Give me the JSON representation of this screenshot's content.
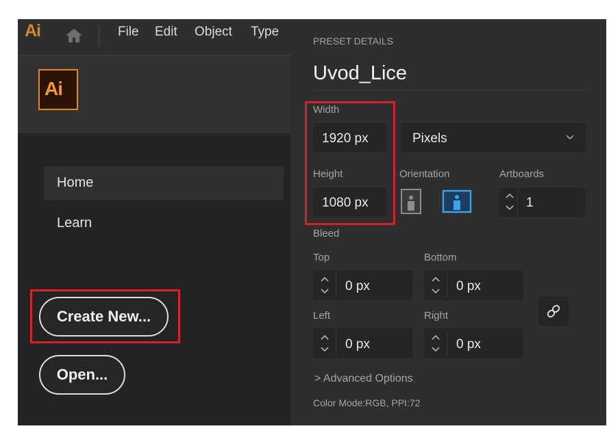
{
  "app": {
    "mark": "Ai",
    "logo_text": "Ai"
  },
  "menu": [
    "File",
    "Edit",
    "Object",
    "Type"
  ],
  "nav": {
    "home": "Home",
    "learn": "Learn"
  },
  "buttons": {
    "create_new": "Create New...",
    "open": "Open..."
  },
  "preset": {
    "section_label": "PRESET DETAILS",
    "name": "Uvod_Lice",
    "width_label": "Width",
    "width_value": "1920 px",
    "units": "Pixels",
    "height_label": "Height",
    "height_value": "1080 px",
    "orientation_label": "Orientation",
    "orientation_selected": "landscape",
    "artboards_label": "Artboards",
    "artboards_value": "1",
    "bleed_label": "Bleed",
    "bleed": {
      "top_label": "Top",
      "top": "0 px",
      "bottom_label": "Bottom",
      "bottom": "0 px",
      "left_label": "Left",
      "left": "0 px",
      "right_label": "Right",
      "right": "0 px"
    },
    "advanced": "> Advanced Options",
    "color_mode": "Color Mode:RGB, PPI:72"
  },
  "colors": {
    "accent_orange": "#e6891f",
    "highlight_red": "#d5232c",
    "orientation_active": "#3ba2f0"
  },
  "icons": [
    "home-icon",
    "chevron-down-icon",
    "portrait-icon",
    "landscape-icon",
    "spinner-icon",
    "link-icon"
  ]
}
